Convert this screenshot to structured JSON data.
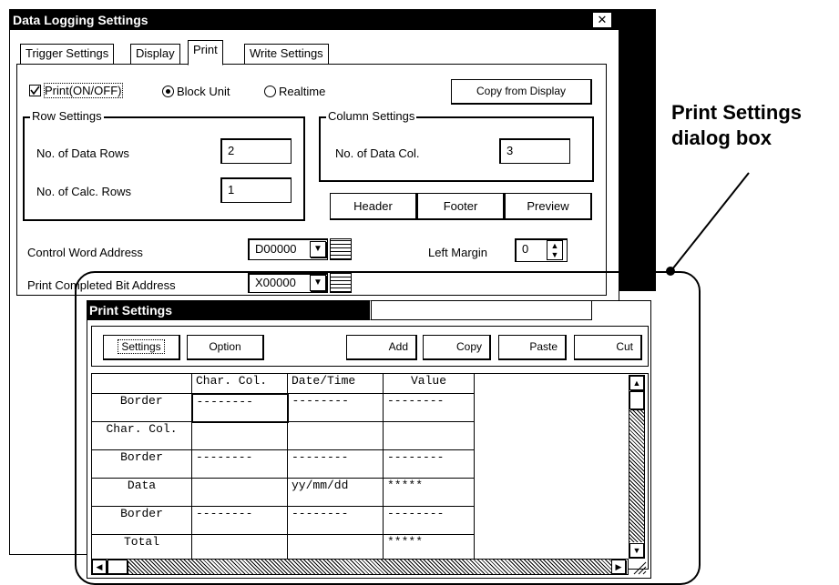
{
  "main_window": {
    "title": "Data Logging Settings",
    "close": "✕",
    "tabs": [
      "Trigger Settings",
      "Display",
      "Print",
      "Write Settings"
    ],
    "print_checkbox": "Print(ON/OFF)",
    "radio_block": "Block Unit",
    "radio_realtime": "Realtime",
    "copy_button": "Copy from Display",
    "row_settings": {
      "legend": "Row Settings",
      "data_rows_label": "No. of Data Rows",
      "data_rows_value": "2",
      "calc_rows_label": "No. of Calc. Rows",
      "calc_rows_value": "1"
    },
    "col_settings": {
      "legend": "Column Settings",
      "data_col_label": "No. of Data Col.",
      "data_col_value": "3"
    },
    "header_button": "Header",
    "footer_button": "Footer",
    "preview_button": "Preview",
    "control_word_label": "Control Word Address",
    "control_word_value": "D00000",
    "left_margin_label": "Left Margin",
    "left_margin_value": "0",
    "print_completed_label": "Print Completed Bit Address",
    "print_completed_value": "X00000"
  },
  "callout": {
    "line1": "Print Settings",
    "line2": "dialog box"
  },
  "print_dialog": {
    "title": "Print Settings",
    "toolbar": {
      "settings": "Settings",
      "option": "Option",
      "add": "Add",
      "copy": "Copy",
      "paste": "Paste",
      "cut": "Cut"
    },
    "columns": [
      "",
      "Char. Col.",
      "Date/Time",
      "Value"
    ],
    "rows": [
      [
        "Border",
        "--------",
        "--------",
        "--------"
      ],
      [
        "Char. Col.",
        "",
        "",
        ""
      ],
      [
        "Border",
        "--------",
        "--------",
        "--------"
      ],
      [
        "Data",
        "",
        "yy/mm/dd",
        "*****"
      ],
      [
        "Border",
        "--------",
        "--------",
        "--------"
      ],
      [
        "Total",
        "",
        "",
        "*****"
      ]
    ]
  }
}
